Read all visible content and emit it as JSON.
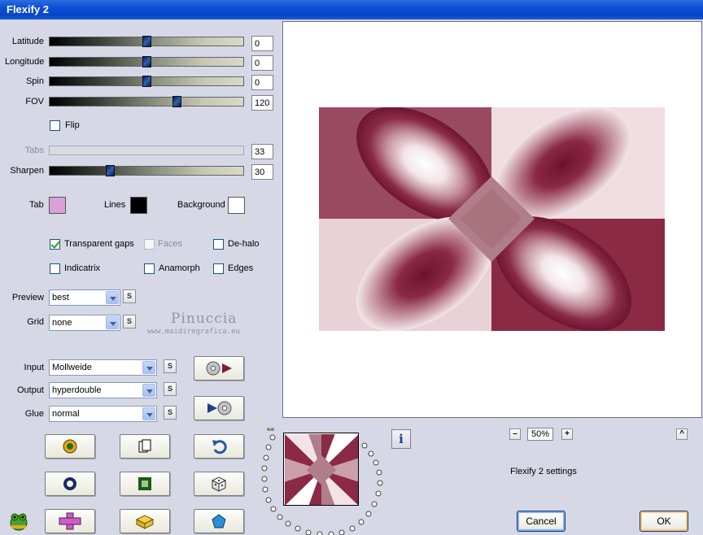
{
  "window": {
    "title": "Flexify 2"
  },
  "sliders": [
    {
      "label": "Latitude",
      "value": "0",
      "fraction": 0.5
    },
    {
      "label": "Longitude",
      "value": "0",
      "fraction": 0.5
    },
    {
      "label": "Spin",
      "value": "0",
      "fraction": 0.5
    },
    {
      "label": "FOV",
      "value": "120",
      "fraction": 0.66
    },
    {
      "label": "Tabs",
      "value": "33",
      "disabled": true
    },
    {
      "label": "Sharpen",
      "value": "30",
      "fraction": 0.3
    }
  ],
  "flip": {
    "label": "Flip",
    "checked": false
  },
  "colors": {
    "tab": {
      "label": "Tab",
      "color": "#d9a0d9"
    },
    "lines": {
      "label": "Lines",
      "color": "#000000"
    },
    "background": {
      "label": "Background",
      "color": "#ffffff"
    }
  },
  "checkboxes": {
    "transparent_gaps": {
      "label": "Transparent gaps",
      "checked": true
    },
    "faces": {
      "label": "Faces",
      "checked": false,
      "disabled": true
    },
    "de_halo": {
      "label": "De-halo",
      "checked": false
    },
    "indicatrix": {
      "label": "Indicatrix",
      "checked": false
    },
    "anamorph": {
      "label": "Anamorph",
      "checked": false
    },
    "edges": {
      "label": "Edges",
      "checked": false
    }
  },
  "preview": {
    "label": "Preview",
    "value": "best"
  },
  "grid": {
    "label": "Grid",
    "value": "none"
  },
  "input": {
    "label": "Input",
    "value": "Mollweide"
  },
  "output": {
    "label": "Output",
    "value": "hyperdouble"
  },
  "glue": {
    "label": "Glue",
    "value": "normal"
  },
  "s_button_label": "S",
  "watermark": {
    "line1": "Pinuccia",
    "line2": "www.maidiregrafica.eu"
  },
  "zoom": {
    "minus": "–",
    "value": "50%",
    "plus": "+"
  },
  "status_text": "Flexify 2 settings",
  "info_icon": "i",
  "scroll_up": "^",
  "buttons": {
    "cancel": "Cancel",
    "ok": "OK"
  },
  "palette": {
    "dark": "#7d1f38",
    "mid": "#b98a96",
    "light": "#ffffff",
    "accent": "#0a4fd6"
  }
}
